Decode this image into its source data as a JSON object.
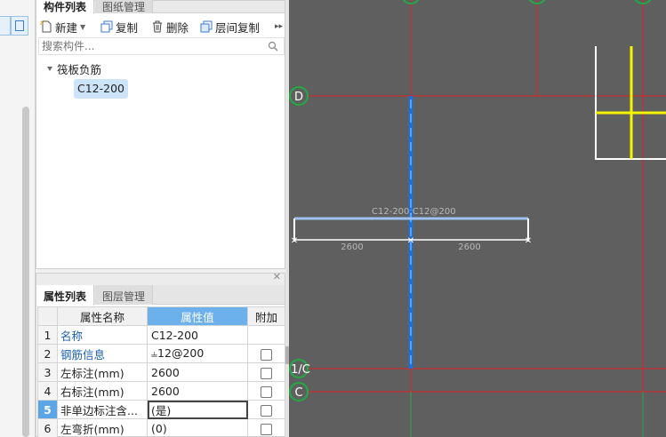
{
  "component_panel": {
    "tabs": [
      {
        "label": "构件列表",
        "active": true
      },
      {
        "label": "图纸管理",
        "active": false
      }
    ],
    "toolbar": {
      "new_label": "新建",
      "copy_label": "复制",
      "delete_label": "删除",
      "floor_copy_label": "层间复制"
    },
    "search": {
      "placeholder": "搜索构件..."
    },
    "tree": {
      "root": "筏板负筋",
      "children": [
        "C12-200"
      ]
    }
  },
  "props_panel": {
    "tabs": [
      {
        "label": "属性列表",
        "active": true
      },
      {
        "label": "图层管理",
        "active": false
      }
    ],
    "headers": {
      "name": "属性名称",
      "value": "属性值",
      "extra": "附加"
    },
    "rows": [
      {
        "no": "1",
        "name": "名称",
        "value": "C12-200",
        "has_checkbox": false,
        "blue": true
      },
      {
        "no": "2",
        "name": "钢筋信息",
        "value": "⫨12@200",
        "has_checkbox": true,
        "blue": true
      },
      {
        "no": "3",
        "name": "左标注(mm)",
        "value": "2600",
        "has_checkbox": true,
        "blue": false
      },
      {
        "no": "4",
        "name": "右标注(mm)",
        "value": "2600",
        "has_checkbox": true,
        "blue": false
      },
      {
        "no": "5",
        "name": "非单边标注含...",
        "value": "(是)",
        "has_checkbox": true,
        "blue": false,
        "selected": true
      },
      {
        "no": "6",
        "name": "左弯折(mm)",
        "value": "(0)",
        "has_checkbox": true,
        "blue": false
      }
    ]
  },
  "canvas": {
    "axis_labels": [
      "D",
      "1/C",
      "C"
    ],
    "rebar_label": "C12-200;C12@200",
    "dim_left": "2600",
    "dim_right": "2600",
    "colors": {
      "background": "#5f5f5f",
      "axis_red": "#e02020",
      "green": "#22aa44",
      "rebar_blue": "#1e6fd9",
      "rebar_light": "#9fc3f0",
      "yellow": "#f5f500",
      "white": "#ffffff"
    }
  }
}
